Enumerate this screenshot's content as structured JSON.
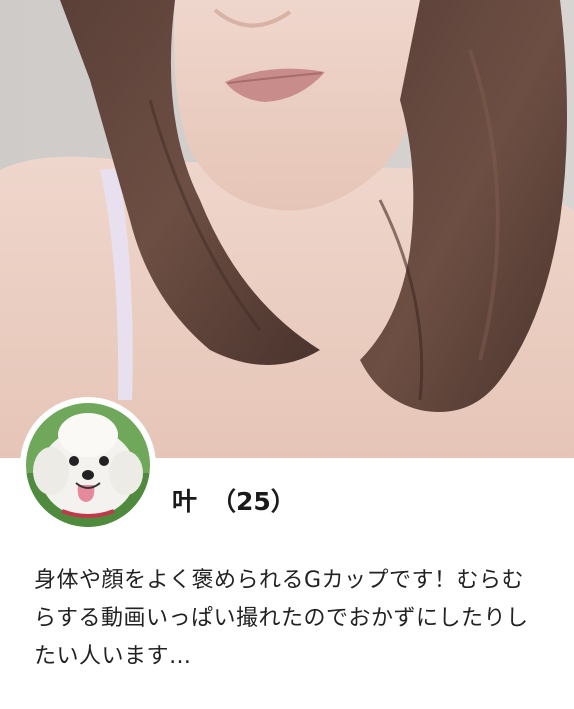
{
  "profile": {
    "name": "叶",
    "age": "（25）",
    "bio": "身体や顔をよく褒められるGカップです！むらむらする動画いっぱい撮れたのでおかずにしたりしたい人います…"
  },
  "images": {
    "cover": "cover-photo",
    "avatar": "dog-avatar-photo"
  },
  "colors": {
    "text": "#222222",
    "background": "#ffffff"
  }
}
